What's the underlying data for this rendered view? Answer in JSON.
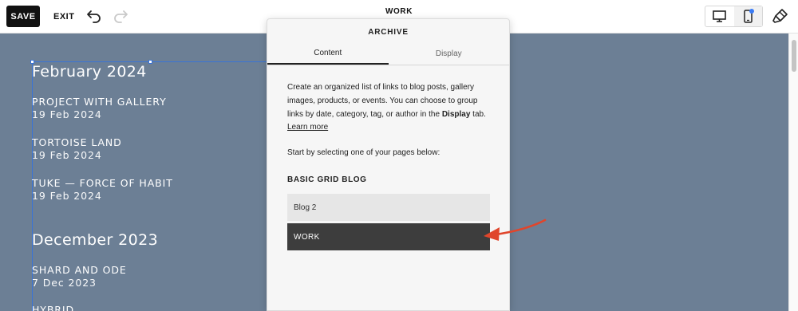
{
  "toolbar": {
    "save_label": "SAVE",
    "exit_label": "EXIT",
    "page_name": "WORK",
    "icons": [
      "undo-icon",
      "redo-icon",
      "desktop-icon",
      "mobile-icon",
      "paintbrush-icon"
    ]
  },
  "canvas": {
    "background": "#6c7f95",
    "groups": [
      {
        "month": "February 2024",
        "posts": [
          {
            "title": "PROJECT WITH GALLERY",
            "date": "19 Feb 2024"
          },
          {
            "title": "TORTOISE LAND",
            "date": "19 Feb 2024"
          },
          {
            "title": "TUKE — FORCE OF HABIT",
            "date": "19 Feb 2024"
          }
        ]
      },
      {
        "month": "December 2023",
        "posts": [
          {
            "title": "SHARD AND ODE",
            "date": "7 Dec 2023"
          },
          {
            "title": "HYBRID",
            "date": ""
          }
        ]
      }
    ]
  },
  "panel": {
    "title": "ARCHIVE",
    "tabs": [
      "Content",
      "Display"
    ],
    "description_1": "Create an organized list of links to blog posts, gallery images, products, or events. You can choose to group links by date, category, tag, or author in the ",
    "description_bold": "Display",
    "description_2": " tab. ",
    "learn_more": "Learn more",
    "start_text": "Start by selecting one of your pages below:",
    "section_label": "BASIC GRID BLOG",
    "options": [
      {
        "label": "Blog 2",
        "selected": false
      },
      {
        "label": "WORK",
        "selected": true
      }
    ]
  },
  "colors": {
    "accent": "#3a74d6",
    "annotation_arrow": "#e0452b"
  }
}
